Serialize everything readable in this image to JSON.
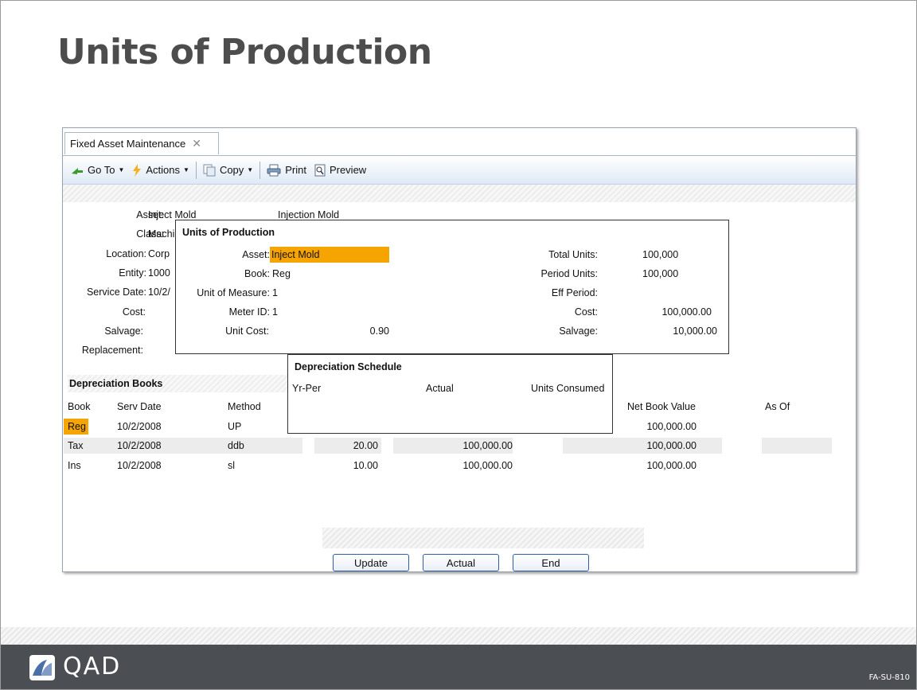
{
  "slide": {
    "title": "Units of Production",
    "footer_code": "FA-SU-810",
    "logo_text": "QAD"
  },
  "window": {
    "tab_label": "Fixed Asset Maintenance",
    "toolbar": {
      "goto": "Go To",
      "actions": "Actions",
      "copy": "Copy",
      "print": "Print",
      "preview": "Preview"
    }
  },
  "asset_form": {
    "asset_label": "Asset:",
    "asset_value": "Inject Mold",
    "asset_desc": "Injection Mold",
    "class_label": "Class:",
    "class_value": "Machi",
    "location_label": "Location:",
    "location_value": "Corp",
    "entity_label": "Entity:",
    "entity_value": "1000",
    "service_date_label": "Service Date:",
    "service_date_value": "10/2/",
    "cost_label": "Cost:",
    "salvage_label": "Salvage:",
    "replacement_label": "Replacement:"
  },
  "depreciation_books": {
    "heading": "Depreciation Books",
    "columns": [
      "Book",
      "Serv Date",
      "Method",
      "Net Book Value",
      "As Of"
    ],
    "rows": [
      {
        "book": "Reg",
        "serv_date": "10/2/2008",
        "method": "UP",
        "life": "",
        "cost": "",
        "nbv": "100,000.00"
      },
      {
        "book": "Tax",
        "serv_date": "10/2/2008",
        "method": "ddb",
        "life": "20.00",
        "cost": "100,000.00",
        "nbv": "100,000.00"
      },
      {
        "book": "Ins",
        "serv_date": "10/2/2008",
        "method": "sl",
        "life": "10.00",
        "cost": "100,000.00",
        "nbv": "100,000.00"
      }
    ]
  },
  "uop_dialog": {
    "title": "Units of Production",
    "asset_label": "Asset:",
    "asset_value": "Inject Mold",
    "book_label": "Book:",
    "book_value": "Reg",
    "uom_label": "Unit of Measure:",
    "uom_value": "1",
    "meter_label": "Meter ID:",
    "meter_value": "1",
    "unit_cost_label": "Unit Cost:",
    "unit_cost_value": "0.90",
    "total_units_label": "Total Units:",
    "total_units_value": "100,000",
    "period_units_label": "Period Units:",
    "period_units_value": "100,000",
    "eff_period_label": "Eff Period:",
    "eff_period_value": "",
    "cost_label": "Cost:",
    "cost_value": "100,000.00",
    "salvage_label": "Salvage:",
    "salvage_value": "10,000.00"
  },
  "schedule_dialog": {
    "title": "Depreciation Schedule",
    "columns": [
      "Yr-Per",
      "Actual",
      "Units Consumed"
    ]
  },
  "buttons": {
    "update": "Update",
    "actual": "Actual",
    "end": "End"
  },
  "colors": {
    "highlight": "#f6a400",
    "footer": "#4b4f54",
    "title": "#4d4d4d"
  }
}
